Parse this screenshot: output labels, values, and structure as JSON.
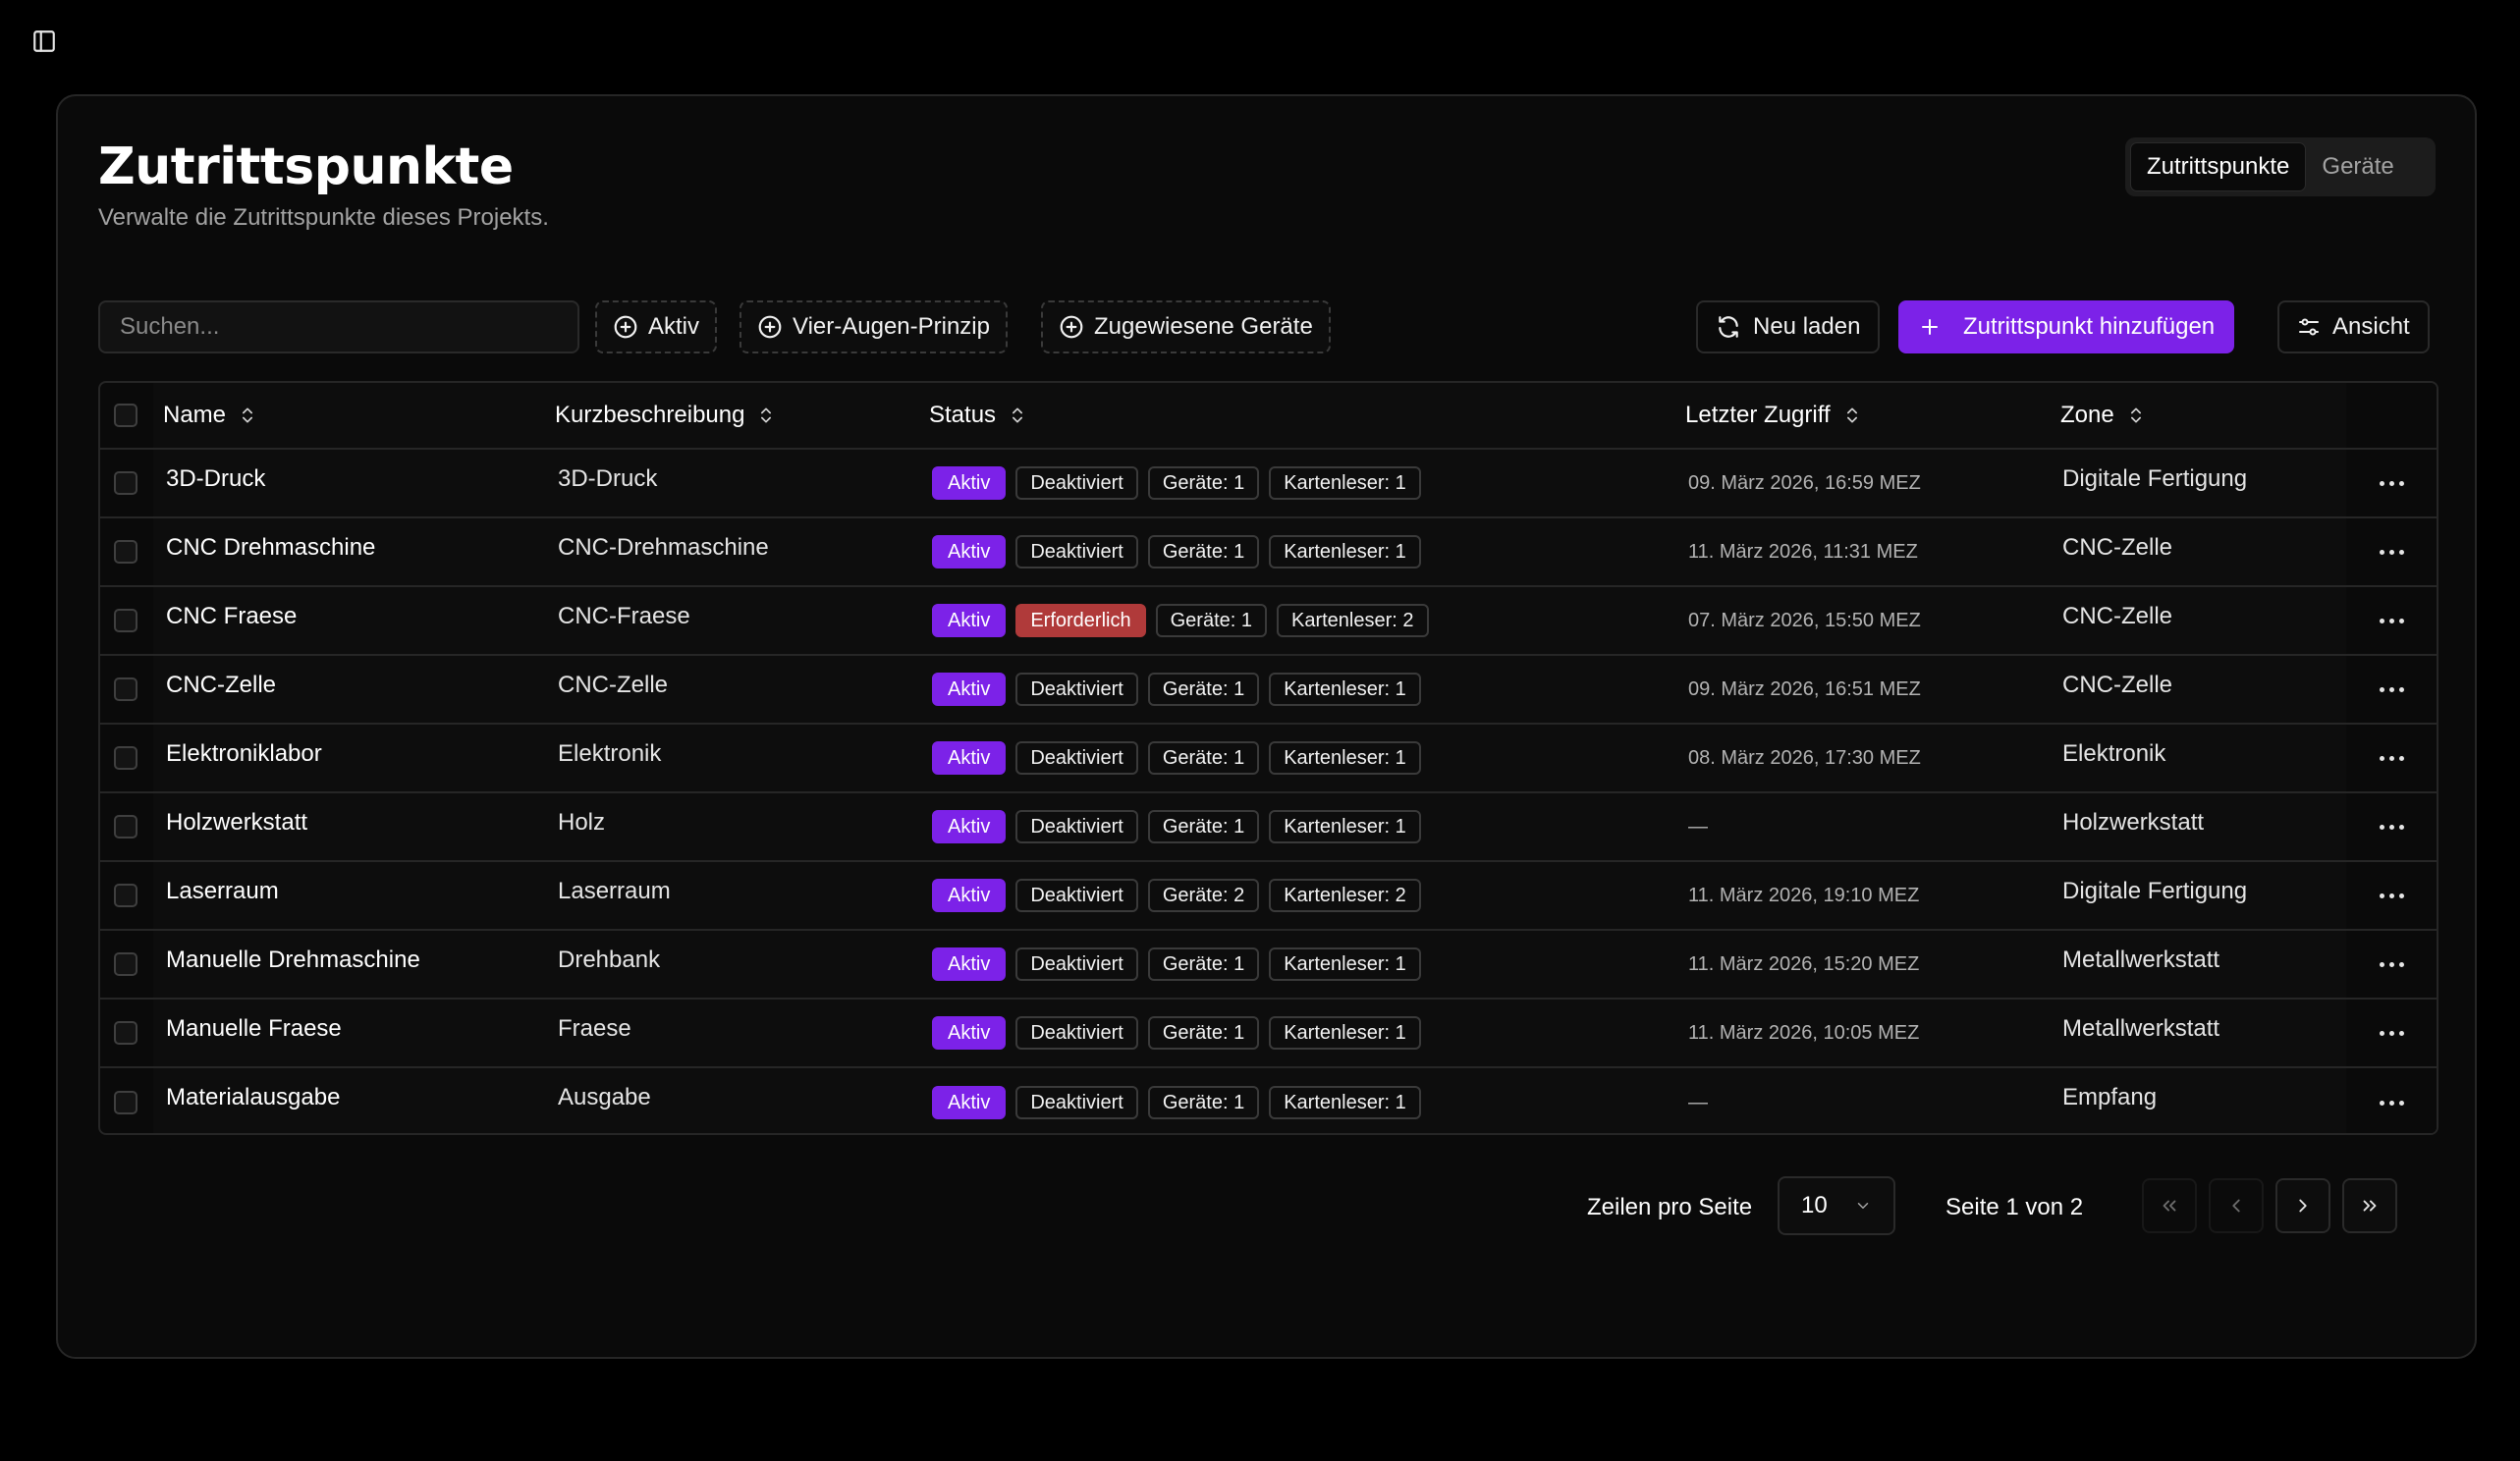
{
  "page": {
    "title": "Zutrittspunkte",
    "subtitle": "Verwalte die Zutrittspunkte dieses Projekts."
  },
  "segmented": {
    "items": [
      {
        "label": "Zutrittspunkte",
        "active": true
      },
      {
        "label": "Geräte",
        "active": false
      }
    ]
  },
  "toolbar": {
    "search_placeholder": "Suchen...",
    "filters": [
      "Aktiv",
      "Vier-Augen-Prinzip",
      "Zugewiesene Geräte"
    ],
    "reload_label": "Neu laden",
    "add_label": "Zutrittspunkt hinzufügen",
    "view_label": "Ansicht"
  },
  "table": {
    "columns": {
      "name": "Name",
      "desc": "Kurzbeschreibung",
      "status": "Status",
      "last_access": "Letzter Zugriff",
      "zone": "Zone"
    },
    "rows": [
      {
        "name": "3D-Druck",
        "desc": "3D-Druck",
        "active": "Aktiv",
        "four_eyes": "Deaktiviert",
        "devices": "Geräte: 1",
        "readers": "Kartenleser: 1",
        "last_access": "09. März 2026, 16:59 MEZ",
        "zone": "Digitale Fertigung"
      },
      {
        "name": "CNC Drehmaschine",
        "desc": "CNC-Drehmaschine",
        "active": "Aktiv",
        "four_eyes": "Deaktiviert",
        "devices": "Geräte: 1",
        "readers": "Kartenleser: 1",
        "last_access": "11. März 2026, 11:31 MEZ",
        "zone": "CNC-Zelle"
      },
      {
        "name": "CNC Fraese",
        "desc": "CNC-Fraese",
        "active": "Aktiv",
        "four_eyes": "Erforderlich",
        "devices": "Geräte: 1",
        "readers": "Kartenleser: 2",
        "last_access": "07. März 2026, 15:50 MEZ",
        "zone": "CNC-Zelle"
      },
      {
        "name": "CNC-Zelle",
        "desc": "CNC-Zelle",
        "active": "Aktiv",
        "four_eyes": "Deaktiviert",
        "devices": "Geräte: 1",
        "readers": "Kartenleser: 1",
        "last_access": "09. März 2026, 16:51 MEZ",
        "zone": "CNC-Zelle"
      },
      {
        "name": "Elektroniklabor",
        "desc": "Elektronik",
        "active": "Aktiv",
        "four_eyes": "Deaktiviert",
        "devices": "Geräte: 1",
        "readers": "Kartenleser: 1",
        "last_access": "08. März 2026, 17:30 MEZ",
        "zone": "Elektronik"
      },
      {
        "name": "Holzwerkstatt",
        "desc": "Holz",
        "active": "Aktiv",
        "four_eyes": "Deaktiviert",
        "devices": "Geräte: 1",
        "readers": "Kartenleser: 1",
        "last_access": "—",
        "zone": "Holzwerkstatt"
      },
      {
        "name": "Laserraum",
        "desc": "Laserraum",
        "active": "Aktiv",
        "four_eyes": "Deaktiviert",
        "devices": "Geräte: 2",
        "readers": "Kartenleser: 2",
        "last_access": "11. März 2026, 19:10 MEZ",
        "zone": "Digitale Fertigung"
      },
      {
        "name": "Manuelle Drehmaschine",
        "desc": "Drehbank",
        "active": "Aktiv",
        "four_eyes": "Deaktiviert",
        "devices": "Geräte: 1",
        "readers": "Kartenleser: 1",
        "last_access": "11. März 2026, 15:20 MEZ",
        "zone": "Metallwerkstatt"
      },
      {
        "name": "Manuelle Fraese",
        "desc": "Fraese",
        "active": "Aktiv",
        "four_eyes": "Deaktiviert",
        "devices": "Geräte: 1",
        "readers": "Kartenleser: 1",
        "last_access": "11. März 2026, 10:05 MEZ",
        "zone": "Metallwerkstatt"
      },
      {
        "name": "Materialausgabe",
        "desc": "Ausgabe",
        "active": "Aktiv",
        "four_eyes": "Deaktiviert",
        "devices": "Geräte: 1",
        "readers": "Kartenleser: 1",
        "last_access": "—",
        "zone": "Empfang"
      }
    ]
  },
  "pagination": {
    "rows_per_page_label": "Zeilen pro Seite",
    "rows_per_page_value": "10",
    "page_info": "Seite 1 von 2"
  },
  "colors": {
    "accent": "#7c22e8",
    "required": "#b03a3a",
    "background": "#000000",
    "card": "#0a0a0a"
  }
}
